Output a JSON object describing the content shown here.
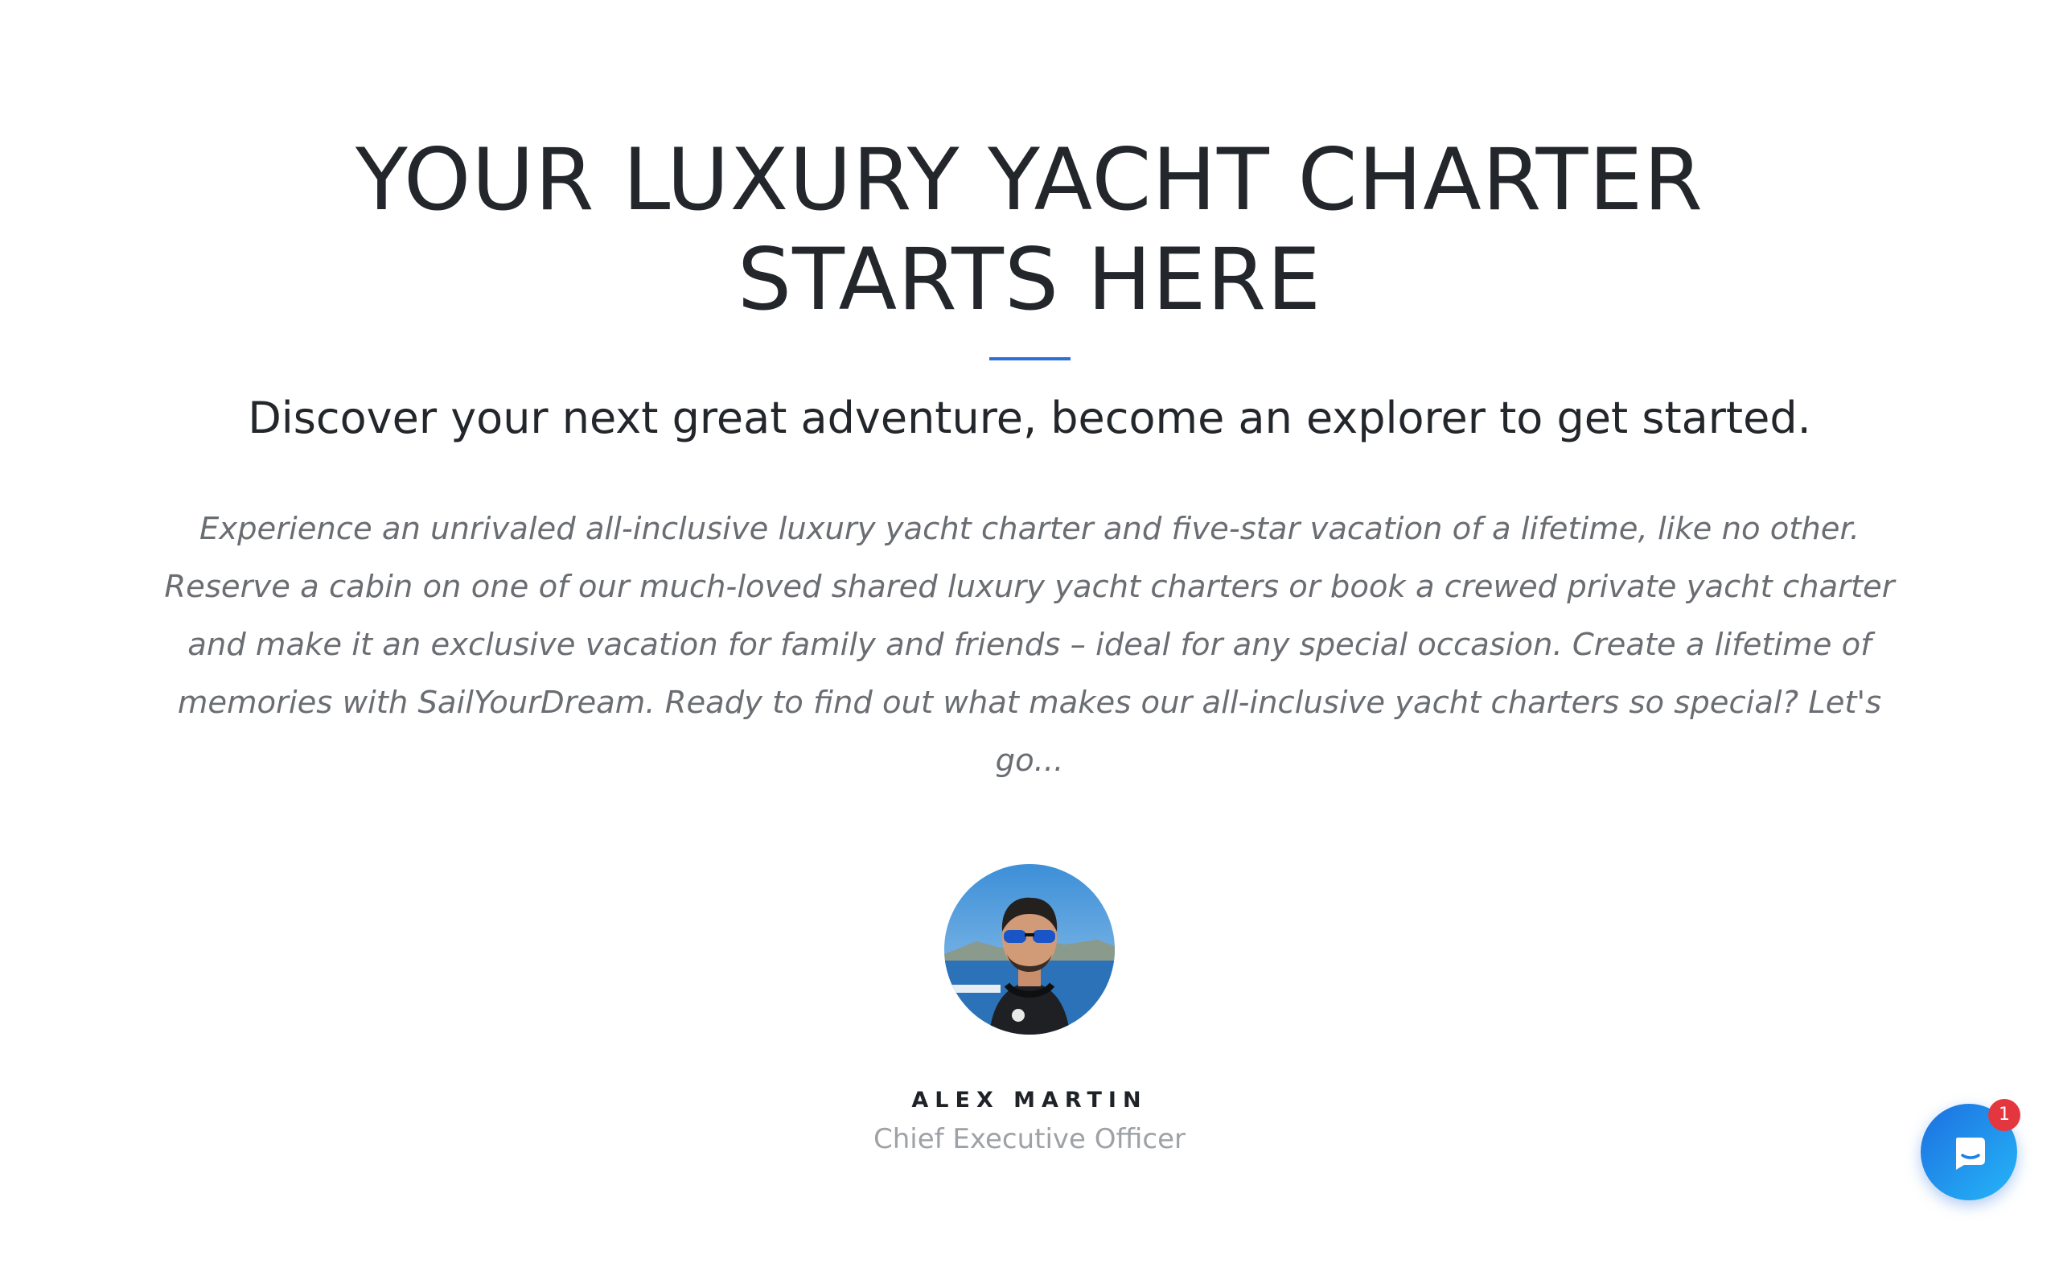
{
  "hero": {
    "headline_line1": "YOUR LUXURY YACHT CHARTER",
    "headline_line2": "STARTS HERE",
    "accent_color": "#2f6fd6",
    "subheadline": "Discover your next great adventure, become an explorer to get started."
  },
  "intro": {
    "lines": [
      "Experience an unrivaled all-inclusive luxury yacht charter and five-star vacation of a lifetime, like no other.",
      "Reserve a cabin on one of our much-loved shared luxury yacht charters or book a crewed private yacht charter",
      "and make it an exclusive vacation for family and friends – ideal for any special occasion. Create a lifetime of",
      "memories with SailYourDream. Ready to find out what makes our all-inclusive yacht charters so special? Let's",
      "go..."
    ]
  },
  "author": {
    "name": "ALEX MARTIN",
    "role": "Chief Executive Officer"
  },
  "chat_widget": {
    "icon": "chat-bubble-icon",
    "unread_count": "1",
    "button_color": "#1d6fe0",
    "badge_color": "#e4363f"
  }
}
